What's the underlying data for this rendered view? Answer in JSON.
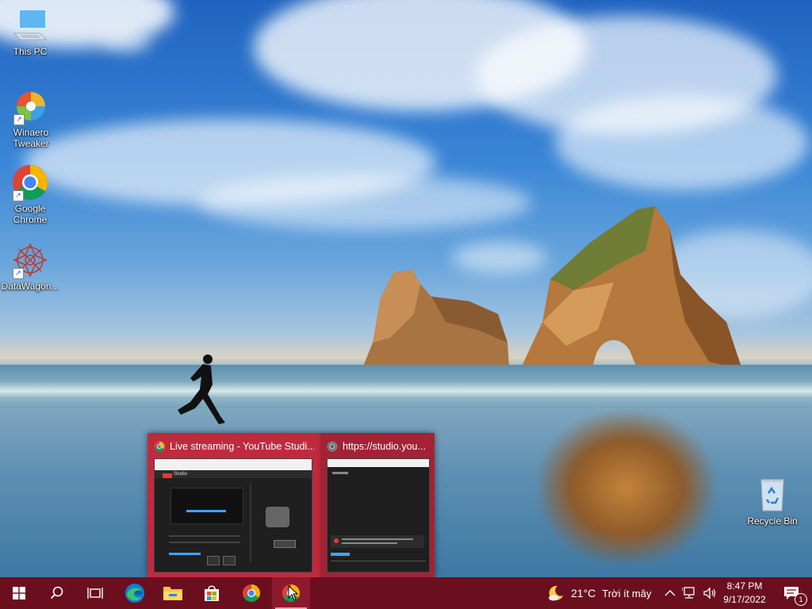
{
  "desktop": {
    "icons": [
      {
        "label": "This PC"
      },
      {
        "label": "Winaero Tweaker"
      },
      {
        "label": "Google Chrome"
      },
      {
        "label": "DataWagon..."
      },
      {
        "label": "Recycle Bin"
      }
    ]
  },
  "thumbnails": [
    {
      "title": "Live streaming - YouTube Studi...",
      "preview_text": "Studio"
    },
    {
      "title": "https://studio.you..."
    }
  ],
  "taskbar": {
    "items": [
      {
        "icon": "windows-start-icon"
      },
      {
        "icon": "search-icon"
      },
      {
        "icon": "task-view-icon"
      },
      {
        "icon": "edge-icon"
      },
      {
        "icon": "file-explorer-icon"
      },
      {
        "icon": "microsoft-store-icon"
      },
      {
        "icon": "chrome-icon"
      },
      {
        "icon": "chrome-active-icon"
      }
    ],
    "weather": {
      "temp": "21°C",
      "condition": "Trời ít mây"
    },
    "clock": {
      "time": "8:47 PM",
      "date": "9/17/2022"
    },
    "notification_count": "1"
  },
  "colors": {
    "taskbar": "#6b0f1f",
    "accent": "#b8273a"
  }
}
